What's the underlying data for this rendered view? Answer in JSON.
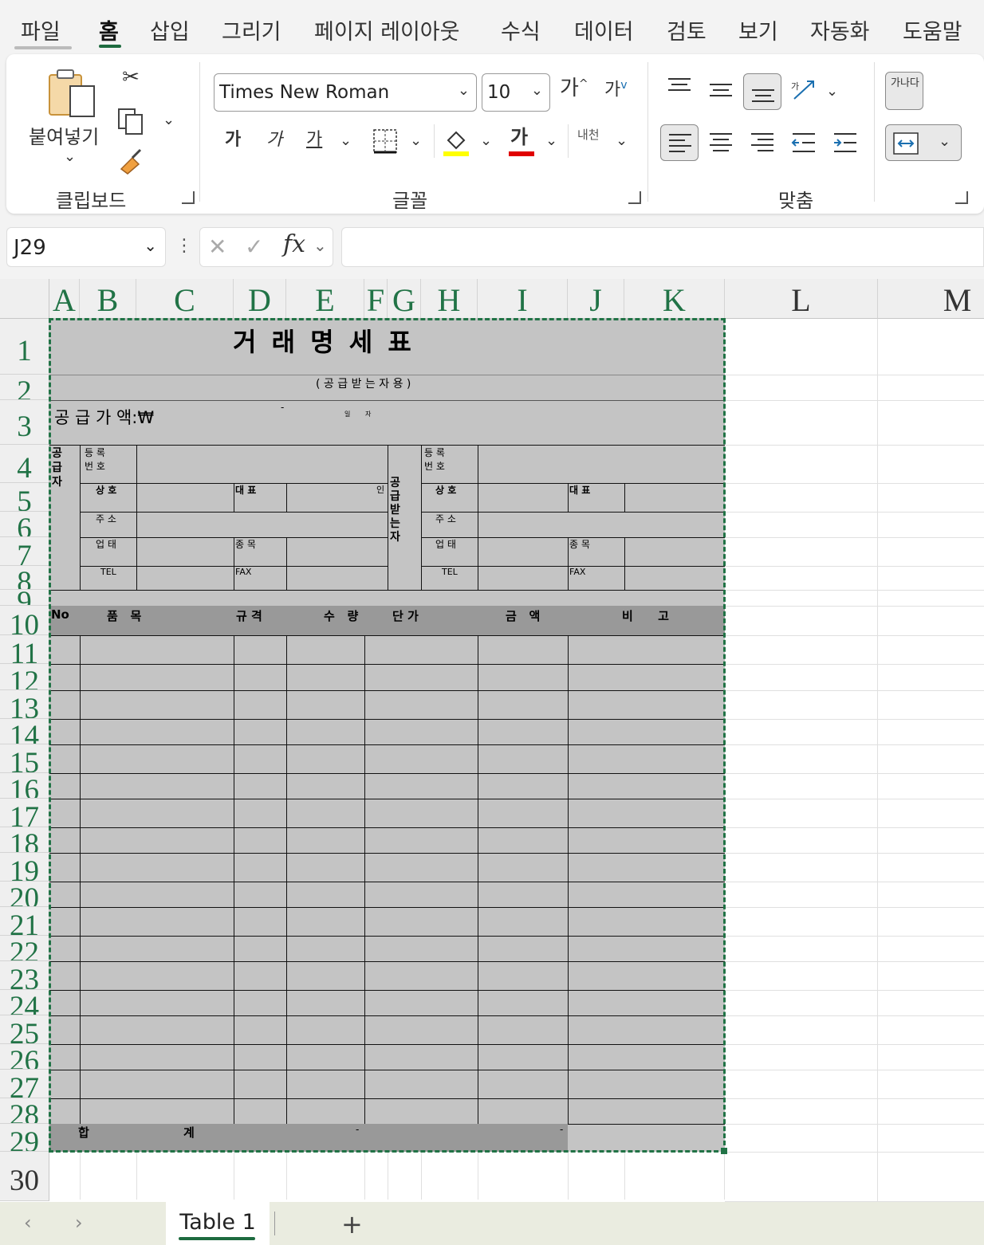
{
  "menu_tabs": [
    {
      "label": "파일"
    },
    {
      "label": "홈"
    },
    {
      "label": "삽입"
    },
    {
      "label": "그리기"
    },
    {
      "label": "페이지 레이아웃"
    },
    {
      "label": "수식"
    },
    {
      "label": "데이터"
    },
    {
      "label": "검토"
    },
    {
      "label": "보기"
    },
    {
      "label": "자동화"
    },
    {
      "label": "도움말"
    }
  ],
  "ribbon": {
    "clipboard": {
      "label": "클립보드",
      "paste_label": "붙여넣기"
    },
    "font": {
      "label": "글꼴",
      "font_name": "Times New Roman",
      "font_size": "10",
      "grow": "가",
      "shrink": "가",
      "bold": "가",
      "italic": "가",
      "underline": "가",
      "font_color_glyph": "가",
      "phonetic": "내천",
      "fill_color": "#ffff00",
      "text_color": "#e00000"
    },
    "alignment": {
      "label": "맞춤",
      "wrap_glyph": "가나다"
    }
  },
  "formula_bar": {
    "cell_ref": "J29",
    "formula": ""
  },
  "columns": [
    "A",
    "B",
    "C",
    "D",
    "E",
    "F",
    "G",
    "H",
    "I",
    "J",
    "K",
    "L",
    "M"
  ],
  "rows": [
    "1",
    "2",
    "3",
    "4",
    "5",
    "6",
    "7",
    "8",
    "9",
    "10",
    "11",
    "12",
    "13",
    "14",
    "15",
    "16",
    "17",
    "18",
    "19",
    "20",
    "21",
    "22",
    "23",
    "24",
    "25",
    "26",
    "27",
    "28",
    "29",
    "30"
  ],
  "sheet": {
    "title": "거 래 명 세 표",
    "subtitle": "( 공 급 받 는 자 용 )",
    "supply_amount": "공 급 가 액:₩",
    "dash": "-",
    "small_il": "일",
    "small_ja": "자",
    "supplier_side": "공급자",
    "receiver_side": "공급받는자",
    "reg_no": "등 록 번 호",
    "company": "상 호",
    "ceo": "대 표",
    "seal": "인",
    "address": "주 소",
    "business_type": "업 태",
    "business_item": "종 목",
    "tel": "TEL",
    "fax": "FAX",
    "headers": {
      "no": "No",
      "item": "품   목",
      "spec": "규 격",
      "qty": "수   량",
      "unit_price": "단 가",
      "amount": "금   액",
      "note": "비      고"
    },
    "total_label_1": "합",
    "total_label_2": "계",
    "total_qty": "-",
    "total_amount": "-"
  },
  "sheet_tabs": [
    {
      "label": "Table 1"
    }
  ],
  "accent_color": "#217346"
}
